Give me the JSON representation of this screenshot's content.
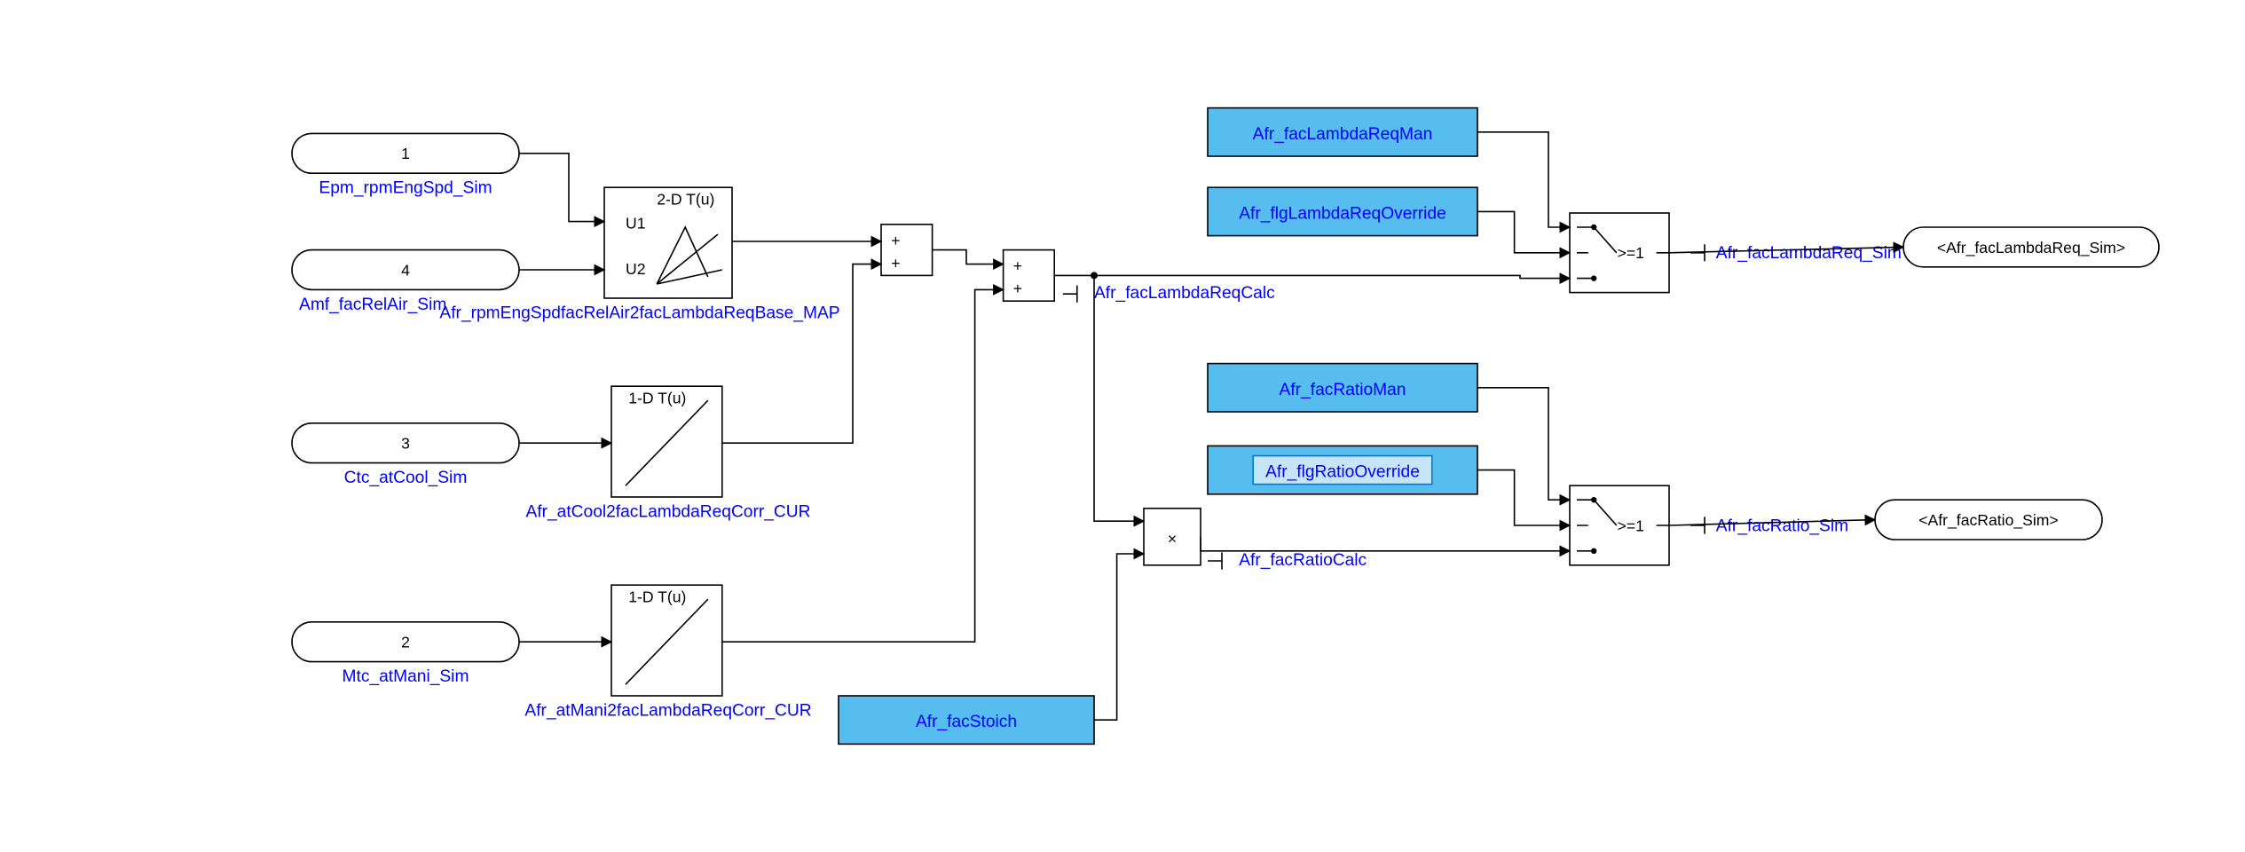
{
  "inports": {
    "p1": {
      "num": "1",
      "label": "Epm_rpmEngSpd_Sim"
    },
    "p4": {
      "num": "4",
      "label": "Amf_facRelAir_Sim"
    },
    "p3": {
      "num": "3",
      "label": "Ctc_atCool_Sim"
    },
    "p2": {
      "num": "2",
      "label": "Mtc_atMani_Sim"
    }
  },
  "lookup2d": {
    "title": "2-D T(u)",
    "u1": "U1",
    "u2": "U2",
    "label": "Afr_rpmEngSpdfacRelAir2facLambdaReqBase_MAP"
  },
  "lookup1d_a": {
    "title": "1-D T(u)",
    "label": "Afr_atCool2facLambdaReqCorr_CUR"
  },
  "lookup1d_b": {
    "title": "1-D T(u)",
    "label": "Afr_atMani2facLambdaReqCorr_CUR"
  },
  "consts": {
    "c1": "Afr_facLambdaReqMan",
    "c2": "Afr_flgLambdaReqOverride",
    "c3": "Afr_facRatioMan",
    "c4": "Afr_flgRatioOverride",
    "c5": "Afr_facStoich"
  },
  "sigs": {
    "s1": "Afr_facLambdaReqCalc",
    "s2": "Afr_facRatioCalc",
    "s3": "Afr_facLambdaReq_Sim",
    "s4": "Afr_facRatio_Sim"
  },
  "switch": {
    "crit": ">=1"
  },
  "outs": {
    "o1": "<Afr_facLambdaReq_Sim>",
    "o2": "<Afr_facRatio_Sim>"
  },
  "prod": {
    "op": "×"
  },
  "sum": {
    "p": "+"
  }
}
